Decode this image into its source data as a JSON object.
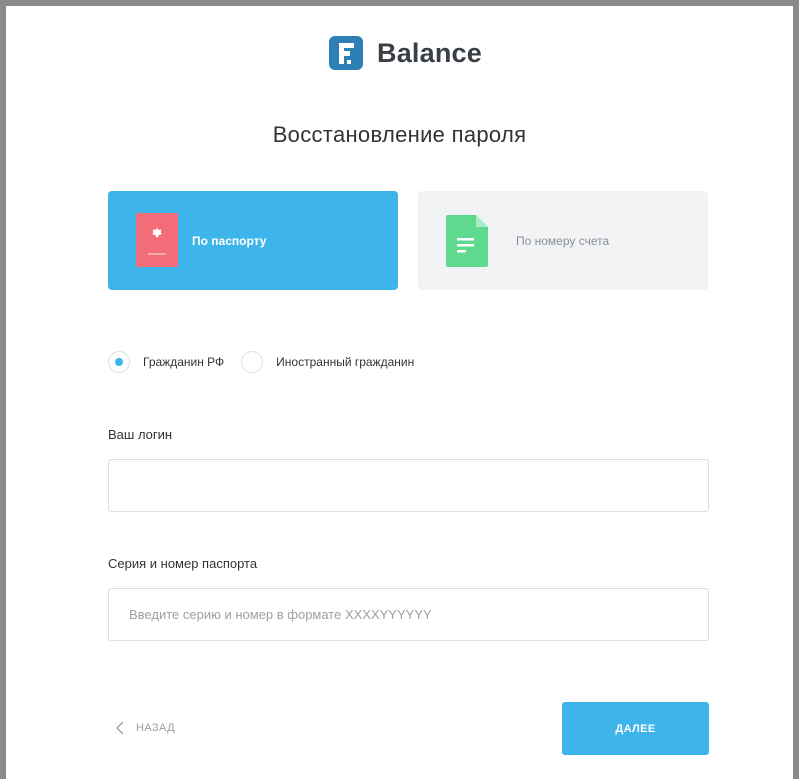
{
  "brand": {
    "name": "Balance",
    "accent": "#3db5ea",
    "logo_color": "#2d7fb6"
  },
  "page": {
    "title": "Восстановление пароля"
  },
  "methods": {
    "passport": {
      "label": "По паспорту",
      "icon": "passport-icon",
      "color": "#3db5ea"
    },
    "account": {
      "label": "По номеру счета",
      "icon": "document-icon",
      "color": "#f2f3f5"
    }
  },
  "citizenship": {
    "options": [
      {
        "label": "Гражданин РФ",
        "checked": true
      },
      {
        "label": "Иностранный гражданин",
        "checked": false
      }
    ]
  },
  "fields": {
    "login": {
      "label": "Ваш логин",
      "value": "",
      "placeholder": ""
    },
    "passport": {
      "label": "Серия и номер паспорта",
      "value": "",
      "placeholder": "Введите серию и номер в формате XXXXYYYYYY"
    }
  },
  "actions": {
    "back_label": "НАЗАД",
    "next_label": "ДАЛЕЕ"
  }
}
